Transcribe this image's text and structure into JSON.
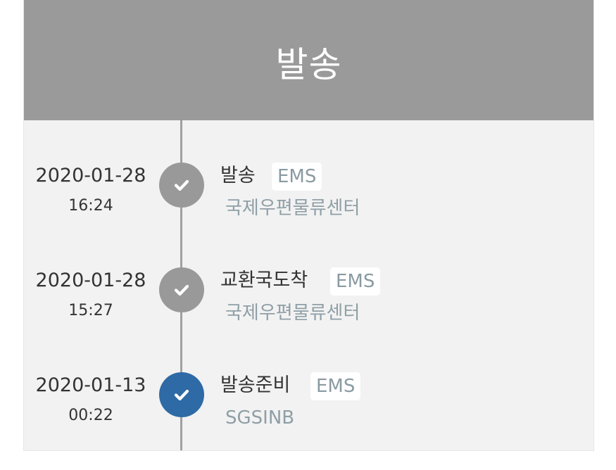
{
  "header": {
    "status_title": "발송"
  },
  "events": [
    {
      "date": "2020-01-28",
      "time": "16:24",
      "status": "발송",
      "mail_type": "EMS",
      "location": "국제우편물류센터",
      "icon": "check-icon",
      "dot_color": "#999999"
    },
    {
      "date": "2020-01-28",
      "time": "15:27",
      "status": "교환국도착",
      "mail_type": "EMS",
      "location": "국제우편물류센터",
      "icon": "check-icon",
      "dot_color": "#999999"
    },
    {
      "date": "2020-01-13",
      "time": "00:22",
      "status": "발송준비",
      "mail_type": "EMS",
      "location": "SGSINB",
      "icon": "check-icon",
      "dot_color": "#2e6aa5",
      "current": true
    }
  ],
  "colors": {
    "header_bg": "#9a9a9a",
    "panel_bg": "#f2f2f2",
    "active_dot": "#2e6aa5",
    "inactive_dot": "#999999",
    "location_text": "#8f9fa6"
  }
}
